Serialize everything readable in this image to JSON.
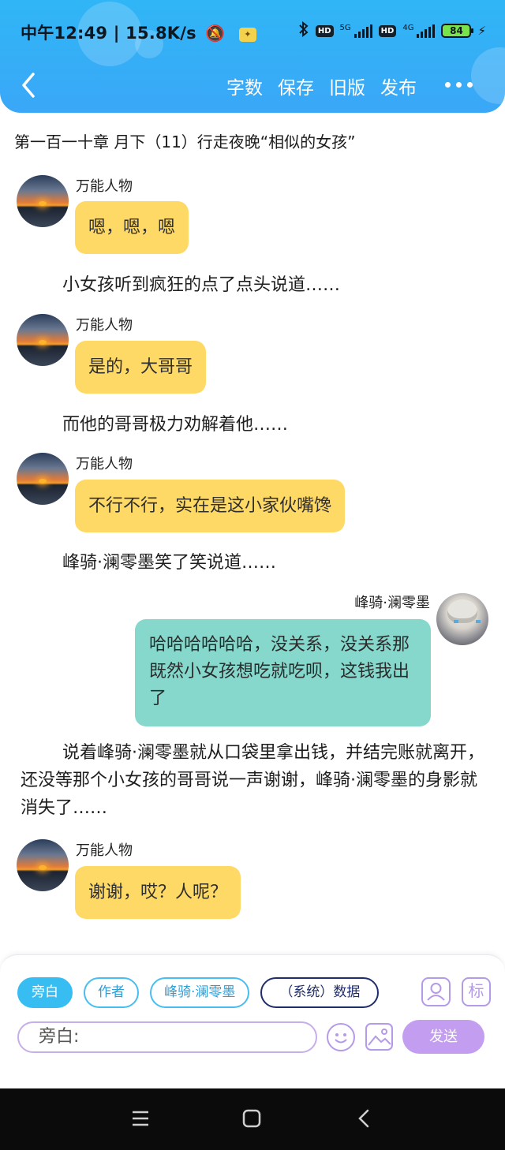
{
  "status_bar": {
    "time_speed": "中午12:49 | 15.8K/s",
    "network1": "5G",
    "network2": "4G",
    "hd_label": "HD",
    "battery": "84"
  },
  "nav": {
    "actions": [
      "字数",
      "保存",
      "旧版",
      "发布"
    ]
  },
  "chapter_title": "第一百一十章  月下（11）行走夜晚“相似的女孩”",
  "messages": [
    {
      "speaker": "万能人物",
      "text": "嗯，嗯，嗯"
    },
    {
      "narration": "小女孩听到疯狂的点了点头说道……"
    },
    {
      "speaker": "万能人物",
      "text": "是的，大哥哥"
    },
    {
      "narration": "而他的哥哥极力劝解着他……"
    },
    {
      "speaker": "万能人物",
      "text": "不行不行，实在是这小家伙嘴馋"
    },
    {
      "narration": "峰骑·澜零墨笑了笑说道……"
    },
    {
      "speaker": "峰骑·澜零墨",
      "text": "哈哈哈哈哈哈，没关系，没关系那既然小女孩想吃就吃呗，这钱我出了"
    },
    {
      "narration": "说着峰骑·澜零墨就从口袋里拿出钱，并结完账就离开，还没等那个小女孩的哥哥说一声谢谢，峰骑·澜零墨的身影就消失了……"
    },
    {
      "speaker": "万能人物",
      "text": "谢谢，哎？人呢？"
    }
  ],
  "composer": {
    "roles": [
      "旁白",
      "作者",
      "峰骑·澜零墨",
      "（系统）数据"
    ],
    "mark_label": "标",
    "input_value": "旁白:",
    "send_label": "发送"
  },
  "colors": {
    "header": "#30b6f6",
    "other_bubble": "#ffd966",
    "self_bubble": "#86d8cc",
    "role_accent": "#38bdf3",
    "send": "#c39df0"
  }
}
